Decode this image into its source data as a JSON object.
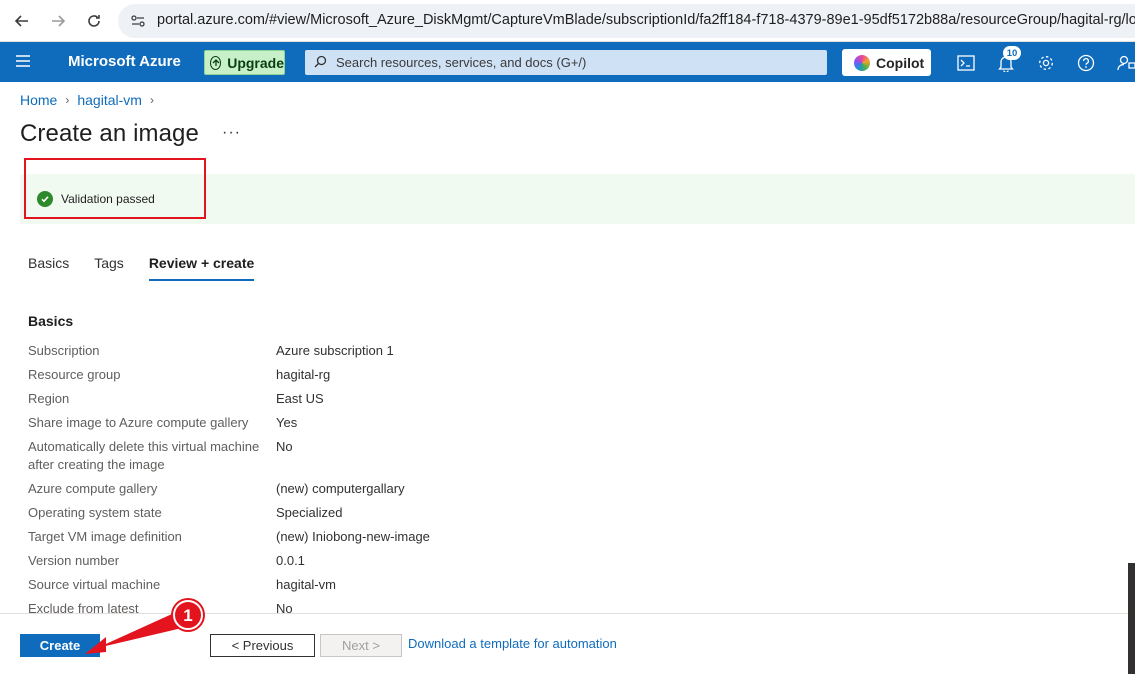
{
  "browser": {
    "url": "portal.azure.com/#view/Microsoft_Azure_DiskMgmt/CaptureVmBlade/subscriptionId/fa2ff184-f718-4379-89e1-95df5172b88a/resourceGroup/hagital-rg/location"
  },
  "header": {
    "brand": "Microsoft Azure",
    "upgrade_label": "Upgrade",
    "search_placeholder": "Search resources, services, and docs (G+/)",
    "copilot_label": "Copilot",
    "notification_count": "10"
  },
  "breadcrumb": [
    "Home",
    "hagital-vm"
  ],
  "page": {
    "title": "Create an image",
    "more": "···",
    "validation_message": "Validation passed"
  },
  "tabs": [
    {
      "label": "Basics",
      "active": false
    },
    {
      "label": "Tags",
      "active": false
    },
    {
      "label": "Review + create",
      "active": true
    }
  ],
  "section": {
    "title": "Basics",
    "rows": [
      {
        "k": "Subscription",
        "v": "Azure subscription 1"
      },
      {
        "k": "Resource group",
        "v": "hagital-rg"
      },
      {
        "k": "Region",
        "v": "East US"
      },
      {
        "k": "Share image to Azure compute gallery",
        "v": "Yes"
      },
      {
        "k": "Automatically delete this virtual machine after creating the image",
        "v": "No"
      },
      {
        "k": "Azure compute gallery",
        "v": "(new) computergallary"
      },
      {
        "k": "Operating system state",
        "v": "Specialized"
      },
      {
        "k": "Target VM image definition",
        "v": "(new) Iniobong-new-image"
      },
      {
        "k": "Version number",
        "v": "0.0.1"
      },
      {
        "k": "Source virtual machine",
        "v": "hagital-vm"
      },
      {
        "k": "Exclude from latest",
        "v": "No"
      }
    ]
  },
  "footer": {
    "create_label": "Create",
    "previous_label": "< Previous",
    "next_label": "Next >",
    "download_link": "Download a template for automation"
  },
  "annotation": {
    "step_number": "1",
    "highlight_color": "#e3141d"
  }
}
